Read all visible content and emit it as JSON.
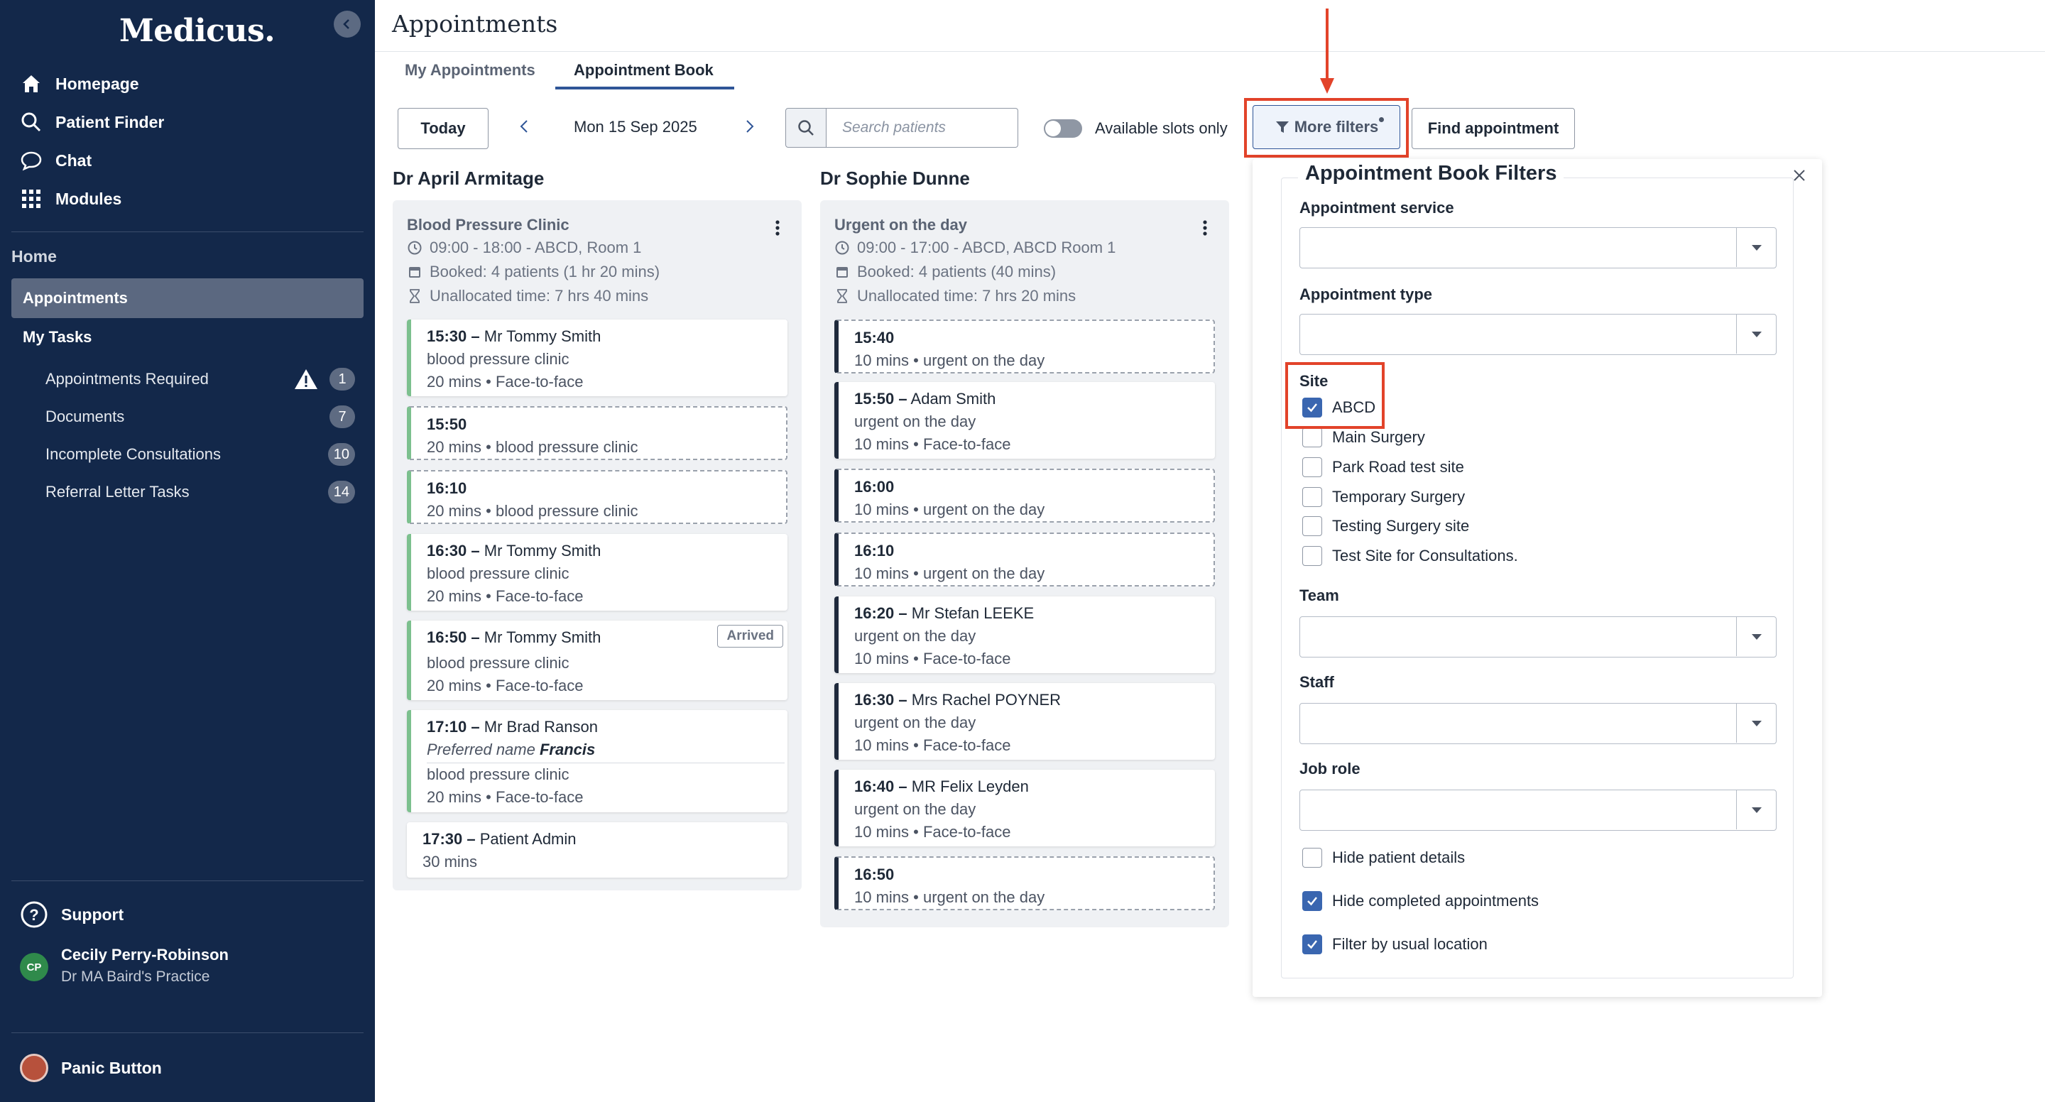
{
  "app": {
    "logo": "Medicus.",
    "page_title": "Appointments"
  },
  "sidebar": {
    "nav": [
      {
        "label": "Homepage",
        "icon": "home-icon"
      },
      {
        "label": "Patient Finder",
        "icon": "search-icon"
      },
      {
        "label": "Chat",
        "icon": "chat-icon"
      },
      {
        "label": "Modules",
        "icon": "grid-icon"
      }
    ],
    "section_label": "Home",
    "active_item": "Appointments",
    "tasks_heading": "My Tasks",
    "tasks": [
      {
        "label": "Appointments Required",
        "count": "1"
      },
      {
        "label": "Documents",
        "count": "7"
      },
      {
        "label": "Incomplete Consultations",
        "count": "10"
      },
      {
        "label": "Referral Letter Tasks",
        "count": "14"
      }
    ],
    "support": "Support",
    "user": {
      "initials": "CP",
      "name": "Cecily Perry-Robinson",
      "practice": "Dr MA Baird's Practice"
    },
    "panic": "Panic Button"
  },
  "tabs": [
    "My Appointments",
    "Appointment Book"
  ],
  "toolbar": {
    "today": "Today",
    "date": "Mon 15 Sep 2025",
    "search_placeholder": "Search patients",
    "available_slots": "Available slots only",
    "more_filters": "More filters",
    "find": "Find appointment"
  },
  "columns": [
    {
      "doctor": "Dr April Armitage",
      "session": "Blood Pressure Clinic",
      "hours": "09:00 - 18:00 - ABCD, Room 1",
      "booked": "Booked: 4 patients (1 hr 20 mins)",
      "unallocated": "Unallocated time: 7 hrs 40 mins",
      "slots": [
        {
          "time": "15:30 –",
          "name": "Mr Tommy Smith",
          "l2": "blood pressure clinic",
          "l3": "20 mins • Face-to-face"
        },
        {
          "time": "15:50",
          "l2": "20 mins • blood pressure clinic"
        },
        {
          "time": "16:10",
          "l2": "20 mins • blood pressure clinic"
        },
        {
          "time": "16:30 –",
          "name": "Mr Tommy Smith",
          "l2": "blood pressure clinic",
          "l3": "20 mins • Face-to-face"
        },
        {
          "time": "16:50 –",
          "name": "Mr Tommy Smith",
          "badge": "Arrived",
          "l2": "blood pressure clinic",
          "l3": "20 mins • Face-to-face"
        },
        {
          "time": "17:10 –",
          "name": "Mr Brad Ranson",
          "pref_label": "Preferred name",
          "pref_name": "Francis",
          "l2": "blood pressure clinic",
          "l3": "20 mins • Face-to-face"
        },
        {
          "time": "17:30 –",
          "name": "Patient Admin",
          "l2": "30 mins"
        }
      ]
    },
    {
      "doctor": "Dr Sophie Dunne",
      "session": "Urgent on the day",
      "hours": "09:00 - 17:00 - ABCD, ABCD Room 1",
      "booked": "Booked: 4 patients (40 mins)",
      "unallocated": "Unallocated time: 7 hrs 20 mins",
      "slots": [
        {
          "time": "15:40",
          "l2": "10 mins • urgent on the day"
        },
        {
          "time": "15:50 –",
          "name": "Adam Smith",
          "l2": "urgent on the day",
          "l3": "10 mins • Face-to-face"
        },
        {
          "time": "16:00",
          "l2": "10 mins • urgent on the day"
        },
        {
          "time": "16:10",
          "l2": "10 mins • urgent on the day"
        },
        {
          "time": "16:20 –",
          "name": "Mr Stefan LEEKE",
          "l2": "urgent on the day",
          "l3": "10 mins • Face-to-face"
        },
        {
          "time": "16:30 –",
          "name": "Mrs Rachel POYNER",
          "l2": "urgent on the day",
          "l3": "10 mins • Face-to-face"
        },
        {
          "time": "16:40 –",
          "name": "MR Felix Leyden",
          "l2": "urgent on the day",
          "l3": "10 mins • Face-to-face"
        },
        {
          "time": "16:50",
          "l2": "10 mins • urgent on the day"
        }
      ]
    }
  ],
  "filters": {
    "title": "Appointment Book Filters",
    "service_label": "Appointment service",
    "type_label": "Appointment type",
    "site_label": "Site",
    "sites": [
      {
        "label": "ABCD",
        "checked": true
      },
      {
        "label": "Main Surgery",
        "checked": false
      },
      {
        "label": "Park Road test site",
        "checked": false
      },
      {
        "label": "Temporary Surgery",
        "checked": false
      },
      {
        "label": "Testing Surgery site",
        "checked": false
      },
      {
        "label": "Test Site for Consultations.",
        "checked": false
      }
    ],
    "team_label": "Team",
    "staff_label": "Staff",
    "job_role_label": "Job role",
    "options": [
      {
        "label": "Hide patient details",
        "checked": false
      },
      {
        "label": "Hide completed appointments",
        "checked": true
      },
      {
        "label": "Filter by usual location",
        "checked": true
      }
    ]
  },
  "colors": {
    "sidebar": "#13284a",
    "accent": "#2f5597",
    "annotation": "#e2432a",
    "booked_border": "#7cc08e"
  }
}
